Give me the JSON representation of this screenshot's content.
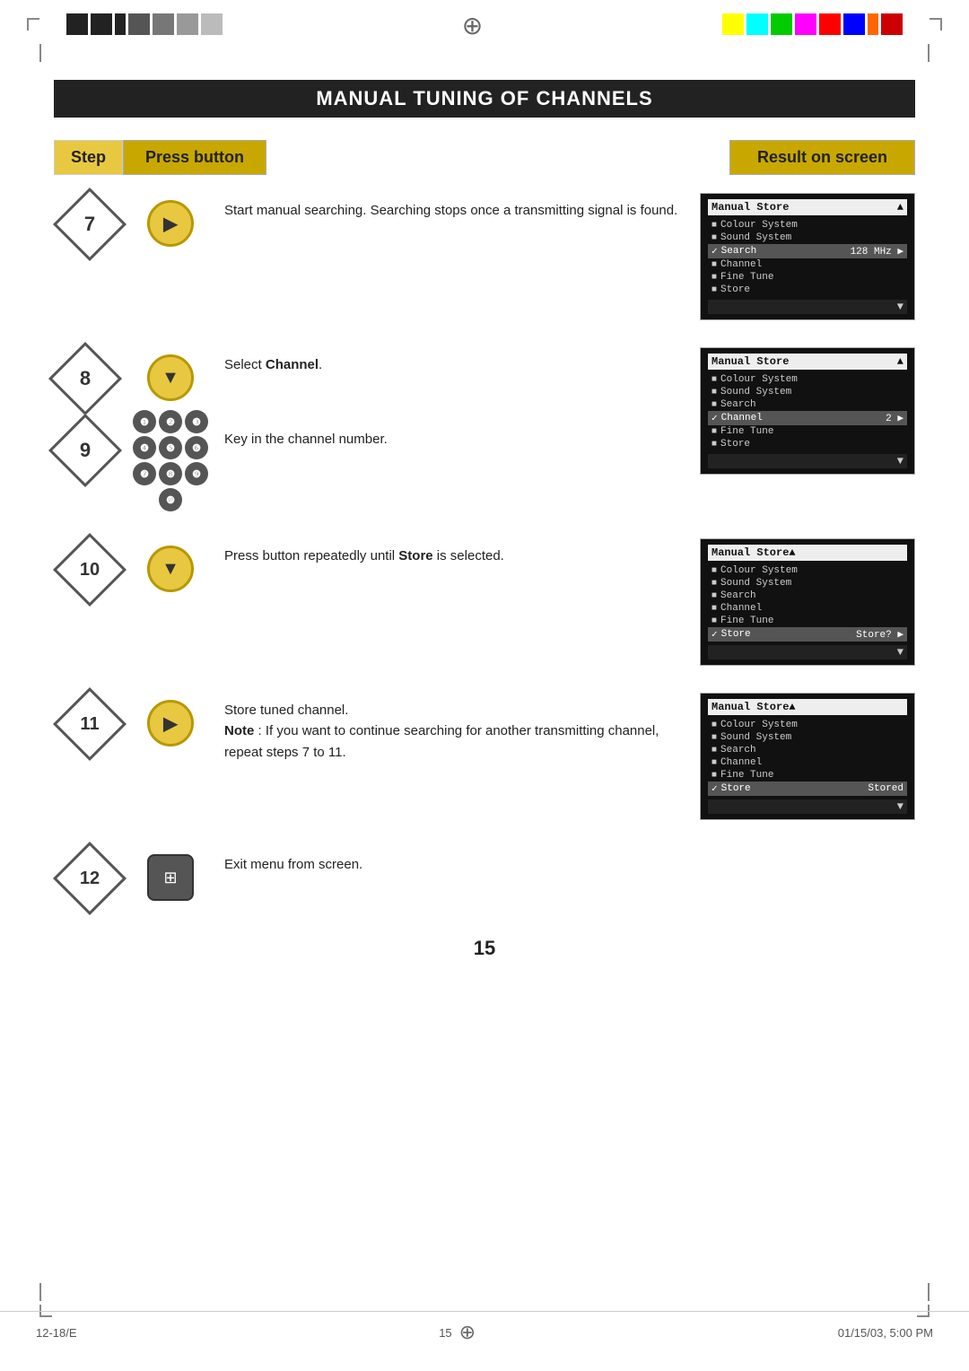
{
  "page": {
    "title": "Manual Tuning of Channels",
    "page_number": "15"
  },
  "header": {
    "step_label": "Step",
    "press_label": "Press button",
    "result_label": "Result on screen"
  },
  "steps": [
    {
      "number": "7",
      "button": "right_arrow",
      "description": "Start manual searching. Searching stops once a transmitting signal is found.",
      "screen": {
        "title": "Manual Store",
        "title_right": "▲",
        "items": [
          {
            "bullet": "■",
            "text": "Colour System"
          },
          {
            "bullet": "■",
            "text": "Sound System"
          },
          {
            "bullet": "✓",
            "text": "Search",
            "right": "128 MHz ▶",
            "highlight": true
          },
          {
            "bullet": "■",
            "text": "Channel"
          },
          {
            "bullet": "■",
            "text": "Fine Tune"
          },
          {
            "bullet": "■",
            "text": "Store"
          }
        ],
        "footer": "▼"
      }
    },
    {
      "number": "8",
      "button": "down_arrow",
      "description": "Select Channel.",
      "description_bold": "Channel",
      "screen": {
        "title": "Manual Store",
        "title_right": "▲",
        "items": [
          {
            "bullet": "■",
            "text": "Colour System"
          },
          {
            "bullet": "■",
            "text": "Sound System"
          },
          {
            "bullet": "■",
            "text": "Search"
          },
          {
            "bullet": "✓",
            "text": "Channel",
            "right": "2 ▶",
            "highlight": true
          },
          {
            "bullet": "■",
            "text": "Fine Tune"
          },
          {
            "bullet": "■",
            "text": "Store"
          }
        ],
        "footer": "▼"
      }
    },
    {
      "number": "9",
      "button": "numpad",
      "description": "Key in the channel number.",
      "screen": null
    },
    {
      "number": "10",
      "button": "down_arrow",
      "description": "Press button repeatedly until Store is selected.",
      "description_bold": "Store",
      "screen": {
        "title": "Manual Store",
        "title_right": "▲",
        "items": [
          {
            "bullet": "■",
            "text": "Colour System"
          },
          {
            "bullet": "■",
            "text": "Sound System"
          },
          {
            "bullet": "■",
            "text": "Search"
          },
          {
            "bullet": "■",
            "text": "Channel"
          },
          {
            "bullet": "■",
            "text": "Fine Tune"
          },
          {
            "bullet": "✓",
            "text": "Store",
            "right": "Store? ▶",
            "highlight": true
          }
        ],
        "footer": "▼"
      }
    },
    {
      "number": "11",
      "button": "right_arrow",
      "description_parts": [
        {
          "text": "Store tuned  channel.",
          "bold": false
        },
        {
          "text": "Note",
          "bold": true
        },
        {
          "text": " : If you want to continue searching for another transmitting channel, repeat steps 7 to 11.",
          "bold": false
        }
      ],
      "screen": {
        "title": "Manual Store",
        "title_right": "▲",
        "items": [
          {
            "bullet": "■",
            "text": "Colour System"
          },
          {
            "bullet": "■",
            "text": "Sound System"
          },
          {
            "bullet": "■",
            "text": "Search"
          },
          {
            "bullet": "■",
            "text": "Channel"
          },
          {
            "bullet": "■",
            "text": "Fine Tune"
          },
          {
            "bullet": "✓",
            "text": "Store",
            "right": "Stored",
            "highlight": true
          }
        ],
        "footer": "▼"
      }
    },
    {
      "number": "12",
      "button": "menu",
      "description": "Exit menu from screen.",
      "screen": null
    }
  ],
  "footer": {
    "left": "12-18/E",
    "center": "15",
    "right": "01/15/03,  5:00 PM"
  },
  "colors": {
    "accent_yellow": "#e8c840",
    "dark_yellow": "#c8a800",
    "dark": "#222222",
    "screen_bg": "#111111"
  }
}
